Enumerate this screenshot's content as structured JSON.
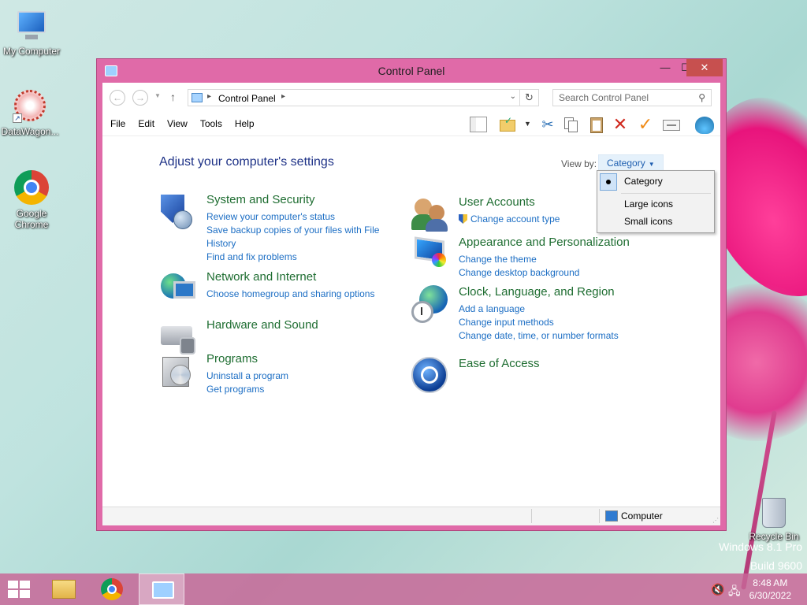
{
  "desktop": {
    "icons": [
      {
        "label": "My Computer"
      },
      {
        "label": "DataWagon..."
      },
      {
        "label": "Google Chrome"
      }
    ],
    "recycle_bin": "Recycle Bin",
    "watermark_line1": "Windows 8.1 Pro",
    "watermark_line2": "Build 9600"
  },
  "window": {
    "title": "Control Panel",
    "minimize": "—",
    "maximize": "☐",
    "close": "✕",
    "address": {
      "crumb": "Control Panel"
    },
    "search": {
      "placeholder": "Search Control Panel"
    },
    "menu": [
      "File",
      "Edit",
      "View",
      "Tools",
      "Help"
    ],
    "heading": "Adjust your computer's settings",
    "view_by": {
      "label": "View by:",
      "value": "Category",
      "options": [
        "Category",
        "Large icons",
        "Small icons"
      ]
    },
    "categories": {
      "system": {
        "title": "System and Security",
        "links": [
          "Review your computer's status",
          "Save backup copies of your files with File History",
          "Find and fix problems"
        ]
      },
      "network": {
        "title": "Network and Internet",
        "links": [
          "Choose homegroup and sharing options"
        ]
      },
      "hardware": {
        "title": "Hardware and Sound"
      },
      "programs": {
        "title": "Programs",
        "links": [
          "Uninstall a program",
          "Get programs"
        ]
      },
      "users": {
        "title": "User Accounts",
        "links": [
          "Change account type"
        ]
      },
      "appearance": {
        "title": "Appearance and Personalization",
        "links": [
          "Change the theme",
          "Change desktop background"
        ]
      },
      "clock": {
        "title": "Clock, Language, and Region",
        "links": [
          "Add a language",
          "Change input methods",
          "Change date, time, or number formats"
        ]
      },
      "ease": {
        "title": "Ease of Access"
      }
    },
    "status": {
      "location": "Computer"
    }
  },
  "taskbar": {
    "time": "8:48 AM",
    "date": "6/30/2022"
  },
  "colors": {
    "window_frame": "#e06aa8",
    "link": "#1c6ec4",
    "category_title": "#1e6d31",
    "heading": "#1e3287",
    "taskbar": "#c86798"
  }
}
